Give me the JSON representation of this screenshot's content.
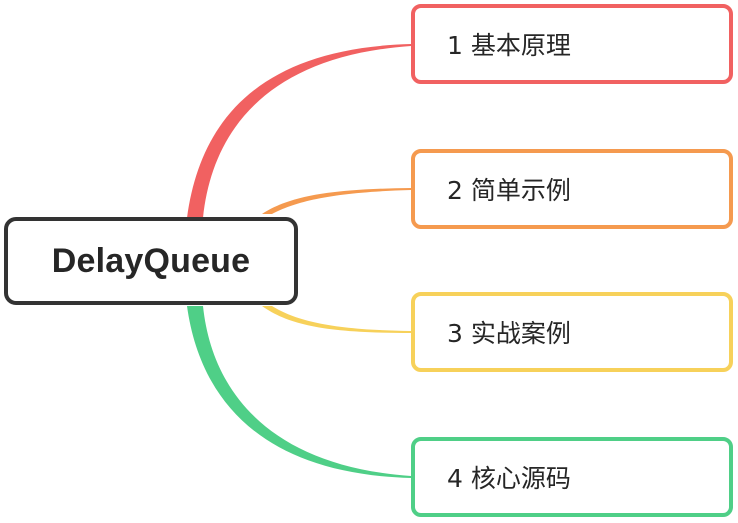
{
  "root": {
    "label": "DelayQueue",
    "border_color": "#333333"
  },
  "branches": [
    {
      "label": "1 基本原理",
      "color": "#f16161"
    },
    {
      "label": "2 简单示例",
      "color": "#f59a4f"
    },
    {
      "label": "3 实战案例",
      "color": "#f7d15a"
    },
    {
      "label": "4 核心源码",
      "color": "#4fcf87"
    }
  ]
}
